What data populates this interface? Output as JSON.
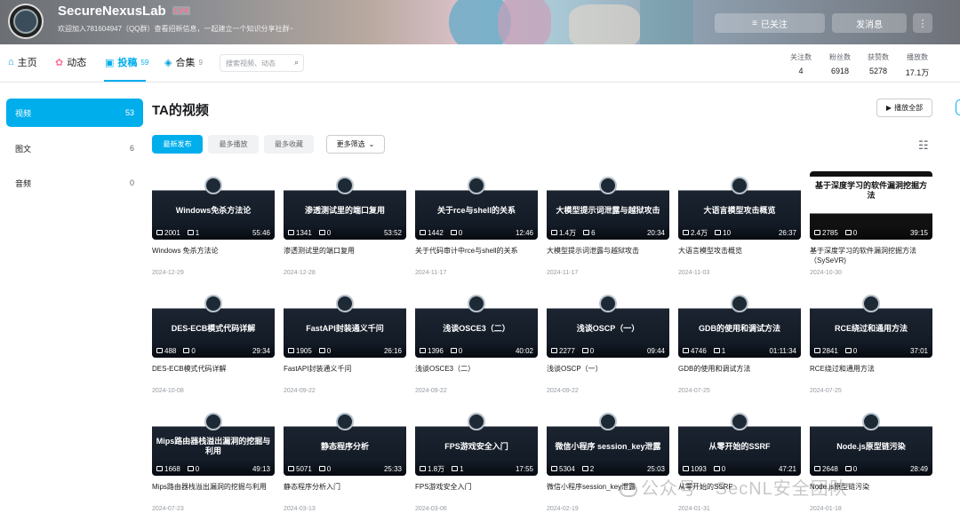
{
  "header": {
    "username": "SecureNexusLab",
    "level": "LV4",
    "sign": "欢迎加入781604947（QQ群）查看招新信息，一起建立一个知识分享社群~",
    "follow_label": "已关注",
    "message_label": "发消息",
    "more_label": "⋮"
  },
  "nav": {
    "tabs": [
      {
        "label": "主页",
        "count": "",
        "icon": "home-icon"
      },
      {
        "label": "动态",
        "count": "",
        "icon": "dynamic-icon"
      },
      {
        "label": "投稿",
        "count": "59",
        "icon": "upload-icon"
      },
      {
        "label": "合集",
        "count": "9",
        "icon": "collection-icon"
      }
    ],
    "search_placeholder": "搜索视频、动态",
    "stats": [
      {
        "label": "关注数",
        "value": "4"
      },
      {
        "label": "粉丝数",
        "value": "6918"
      },
      {
        "label": "获赞数",
        "value": "5278"
      },
      {
        "label": "播放数",
        "value": "17.1万"
      }
    ]
  },
  "sidebar": {
    "items": [
      {
        "label": "视频",
        "count": "53"
      },
      {
        "label": "图文",
        "count": "6"
      },
      {
        "label": "音频",
        "count": "0"
      }
    ]
  },
  "main": {
    "title": "TA的视频",
    "play_all": "播放全部",
    "filters": [
      "最新发布",
      "最多播放",
      "最多收藏",
      "更多筛选"
    ],
    "videos": [
      {
        "thumb": "Windows免杀方法论",
        "views": "2001",
        "danmaku": "1",
        "duration": "55:46",
        "title": "Windows 免杀方法论",
        "date": "2024-12-29"
      },
      {
        "thumb": "渗透测试里的端口复用",
        "views": "1341",
        "danmaku": "0",
        "duration": "53:52",
        "title": "渗透测试里的端口复用",
        "date": "2024-12-28"
      },
      {
        "thumb": "关于rce与shell的关系",
        "views": "1442",
        "danmaku": "0",
        "duration": "12:46",
        "title": "关于代码审计中rce与shell的关系",
        "date": "2024-11-17"
      },
      {
        "thumb": "大模型提示词泄露与越狱攻击",
        "views": "1.4万",
        "danmaku": "6",
        "duration": "20:34",
        "title": "大模型提示词泄露与越狱攻击",
        "date": "2024-11-17"
      },
      {
        "thumb": "大语言模型攻击概览",
        "views": "2.4万",
        "danmaku": "10",
        "duration": "26:37",
        "title": "大语言模型攻击概览",
        "date": "2024-11-03"
      },
      {
        "thumb": "基于深度学习的软件漏洞挖掘方法",
        "views": "2785",
        "danmaku": "0",
        "duration": "39:15",
        "title": "基于深度学习的软件漏洞挖掘方法（SySeVR)",
        "date": "2024-10-30"
      },
      {
        "thumb": "DES-ECB模式代码详解",
        "views": "488",
        "danmaku": "0",
        "duration": "29:34",
        "title": "DES-ECB模式代码详解",
        "date": "2024-10-08"
      },
      {
        "thumb": "FastAPI封装通义千问",
        "views": "1905",
        "danmaku": "0",
        "duration": "26:16",
        "title": "FastAPI封装通义千问",
        "date": "2024-09-22"
      },
      {
        "thumb": "浅谈OSCE3（二）",
        "views": "1396",
        "danmaku": "0",
        "duration": "40:02",
        "title": "浅谈OSCE3（二）",
        "date": "2024-09-22"
      },
      {
        "thumb": "浅谈OSCP（一）",
        "views": "2277",
        "danmaku": "0",
        "duration": "09:44",
        "title": "浅谈OSCP（一）",
        "date": "2024-09-22"
      },
      {
        "thumb": "GDB的使用和调试方法",
        "views": "4746",
        "danmaku": "1",
        "duration": "01:11:34",
        "title": "GDB的使用和调试方法",
        "date": "2024-07-25"
      },
      {
        "thumb": "RCE绕过和通用方法",
        "views": "2841",
        "danmaku": "0",
        "duration": "37:01",
        "title": "RCE绕过和通用方法",
        "date": "2024-07-25"
      },
      {
        "thumb": "Mips路由器栈溢出漏洞的挖掘与利用",
        "views": "1668",
        "danmaku": "0",
        "duration": "49:13",
        "title": "Mips路由器栈溢出漏洞的挖掘与利用",
        "date": "2024-07-23"
      },
      {
        "thumb": "静态程序分析",
        "views": "5071",
        "danmaku": "0",
        "duration": "25:33",
        "title": "静态程序分析入门",
        "date": "2024-03-13"
      },
      {
        "thumb": "FPS游戏安全入门",
        "views": "1.8万",
        "danmaku": "1",
        "duration": "17:55",
        "title": "FPS游戏安全入门",
        "date": "2024-03-06"
      },
      {
        "thumb": "微信小程序 session_key泄露",
        "views": "5304",
        "danmaku": "2",
        "duration": "25:03",
        "title": "微信小程序session_key泄露",
        "date": "2024-02-19"
      },
      {
        "thumb": "从零开始的SSRF",
        "views": "1093",
        "danmaku": "0",
        "duration": "47:21",
        "title": "从零开始的SSRF",
        "date": "2024-01-31"
      },
      {
        "thumb": "Node.js原型链污染",
        "views": "2648",
        "danmaku": "0",
        "duration": "28:49",
        "title": "Node.js原型链污染",
        "date": "2024-01-18"
      }
    ]
  },
  "watermark": "公众号 · SecNL安全团队",
  "colors": {
    "accent": "#00aeec",
    "pink": "#fb7299"
  }
}
